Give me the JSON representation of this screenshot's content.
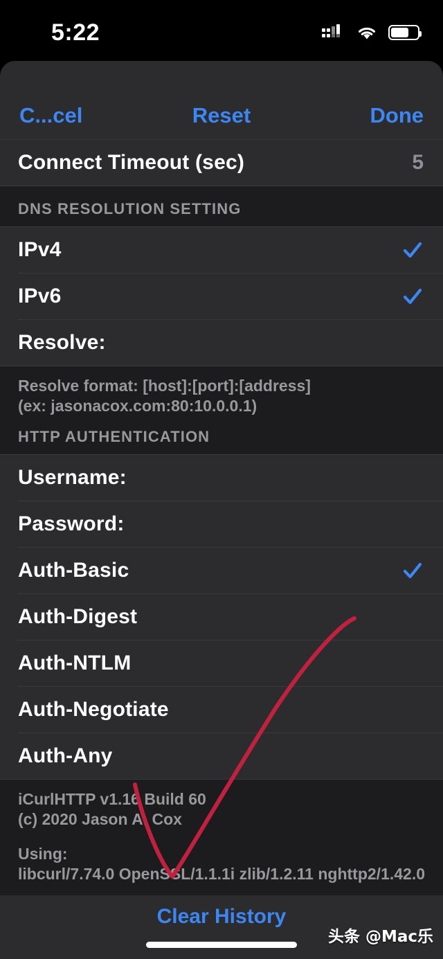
{
  "status_bar": {
    "time": "5:22",
    "cellular_icon": "cellular-signal-icon",
    "wifi_icon": "wifi-icon",
    "battery_icon": "battery-icon"
  },
  "nav": {
    "cancel_label": "C...cel",
    "reset_label": "Reset",
    "done_label": "Done"
  },
  "timeout_row": {
    "label": "Connect Timeout (sec)",
    "value": "5"
  },
  "dns_section": {
    "header": "DNS RESOLUTION SETTING",
    "rows": [
      {
        "label": "IPv4",
        "checked": true
      },
      {
        "label": "IPv6",
        "checked": true
      },
      {
        "label": "Resolve:",
        "checked": false
      }
    ],
    "footer_line1": "Resolve format: [host]:[port]:[address]",
    "footer_line2": "(ex: jasonacox.com:80:10.0.0.1)"
  },
  "auth_section": {
    "header": "HTTP AUTHENTICATION",
    "rows": [
      {
        "label": "Username:",
        "checked": false
      },
      {
        "label": "Password:",
        "checked": false
      },
      {
        "label": "Auth-Basic",
        "checked": true
      },
      {
        "label": "Auth-Digest",
        "checked": false
      },
      {
        "label": "Auth-NTLM",
        "checked": false
      },
      {
        "label": "Auth-Negotiate",
        "checked": false
      },
      {
        "label": "Auth-Any",
        "checked": false
      }
    ]
  },
  "about_footer": {
    "line1": "iCurlHTTP v1.16 Build 60",
    "line2": "(c) 2020 Jason A. Cox",
    "line3": "Using:",
    "line4": "libcurl/7.74.0 OpenSSL/1.1.1i zlib/1.2.11 nghttp2/1.42.0"
  },
  "bottom_bar": {
    "clear_history_label": "Clear History"
  },
  "watermark": {
    "text": "头条 @Mac乐"
  },
  "colors": {
    "accent_blue": "#3d86f5",
    "annotation_red": "#c2203f",
    "row_bg": "#2c2c2e",
    "page_bg": "#1c1c1e",
    "secondary_text": "#98989d",
    "value_text": "#8e9099"
  },
  "annotation": {
    "shape": "red-check-mark-stroke",
    "color": "#c2203f"
  }
}
